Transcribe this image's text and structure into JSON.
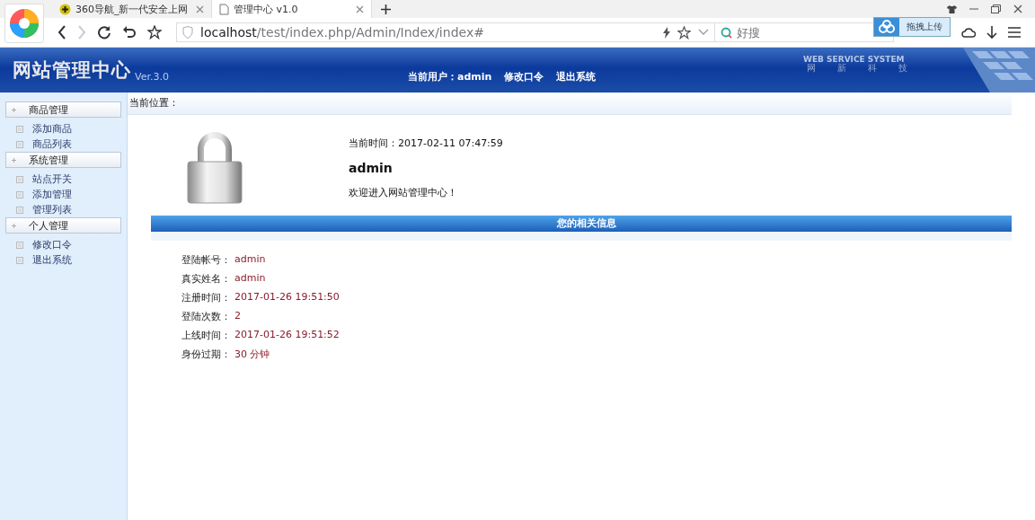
{
  "browser": {
    "tabs": [
      {
        "title": "360导航_新一代安全上网",
        "selected": false,
        "kind": "site"
      },
      {
        "title": "管理中心 v1.0",
        "selected": true,
        "kind": "page"
      }
    ],
    "url": {
      "host": "localhost",
      "path": "/test/index.php/Admin/Index/index#"
    },
    "search": {
      "placeholder": "好搜"
    },
    "upload_button": "拖拽上传"
  },
  "header": {
    "title": "网站管理中心",
    "version": "Ver.3.0",
    "user_label": "当前用户：",
    "user": "admin",
    "links": [
      "修改口令",
      "退出系统"
    ],
    "brand": "WEB SERVICE SYSTEM",
    "brand_sub": [
      "网",
      "新",
      "科",
      "技"
    ]
  },
  "sidebar": {
    "groups": [
      {
        "title": "商品管理",
        "items": [
          "添加商品",
          "商品列表"
        ]
      },
      {
        "title": "系统管理",
        "items": [
          "站点开关",
          "添加管理",
          "管理列表"
        ]
      },
      {
        "title": "个人管理",
        "items": [
          "修改口令",
          "退出系统"
        ]
      }
    ]
  },
  "breadcrumb": "当前位置：",
  "welcome": {
    "time_label": "当前时间：",
    "time": "2017-02-11 07:47:59",
    "user": "admin",
    "message": "欢迎进入网站管理中心！"
  },
  "info": {
    "title": "您的相关信息",
    "rows": [
      {
        "label": "登陆帐号：",
        "value": "admin"
      },
      {
        "label": "真实姓名：",
        "value": "admin"
      },
      {
        "label": "注册时间：",
        "value": "2017-01-26 19:51:50"
      },
      {
        "label": "登陆次数：",
        "value": "2"
      },
      {
        "label": "上线时间：",
        "value": "2017-01-26 19:51:52"
      },
      {
        "label": "身份过期：",
        "value": "30 分钟"
      }
    ]
  }
}
